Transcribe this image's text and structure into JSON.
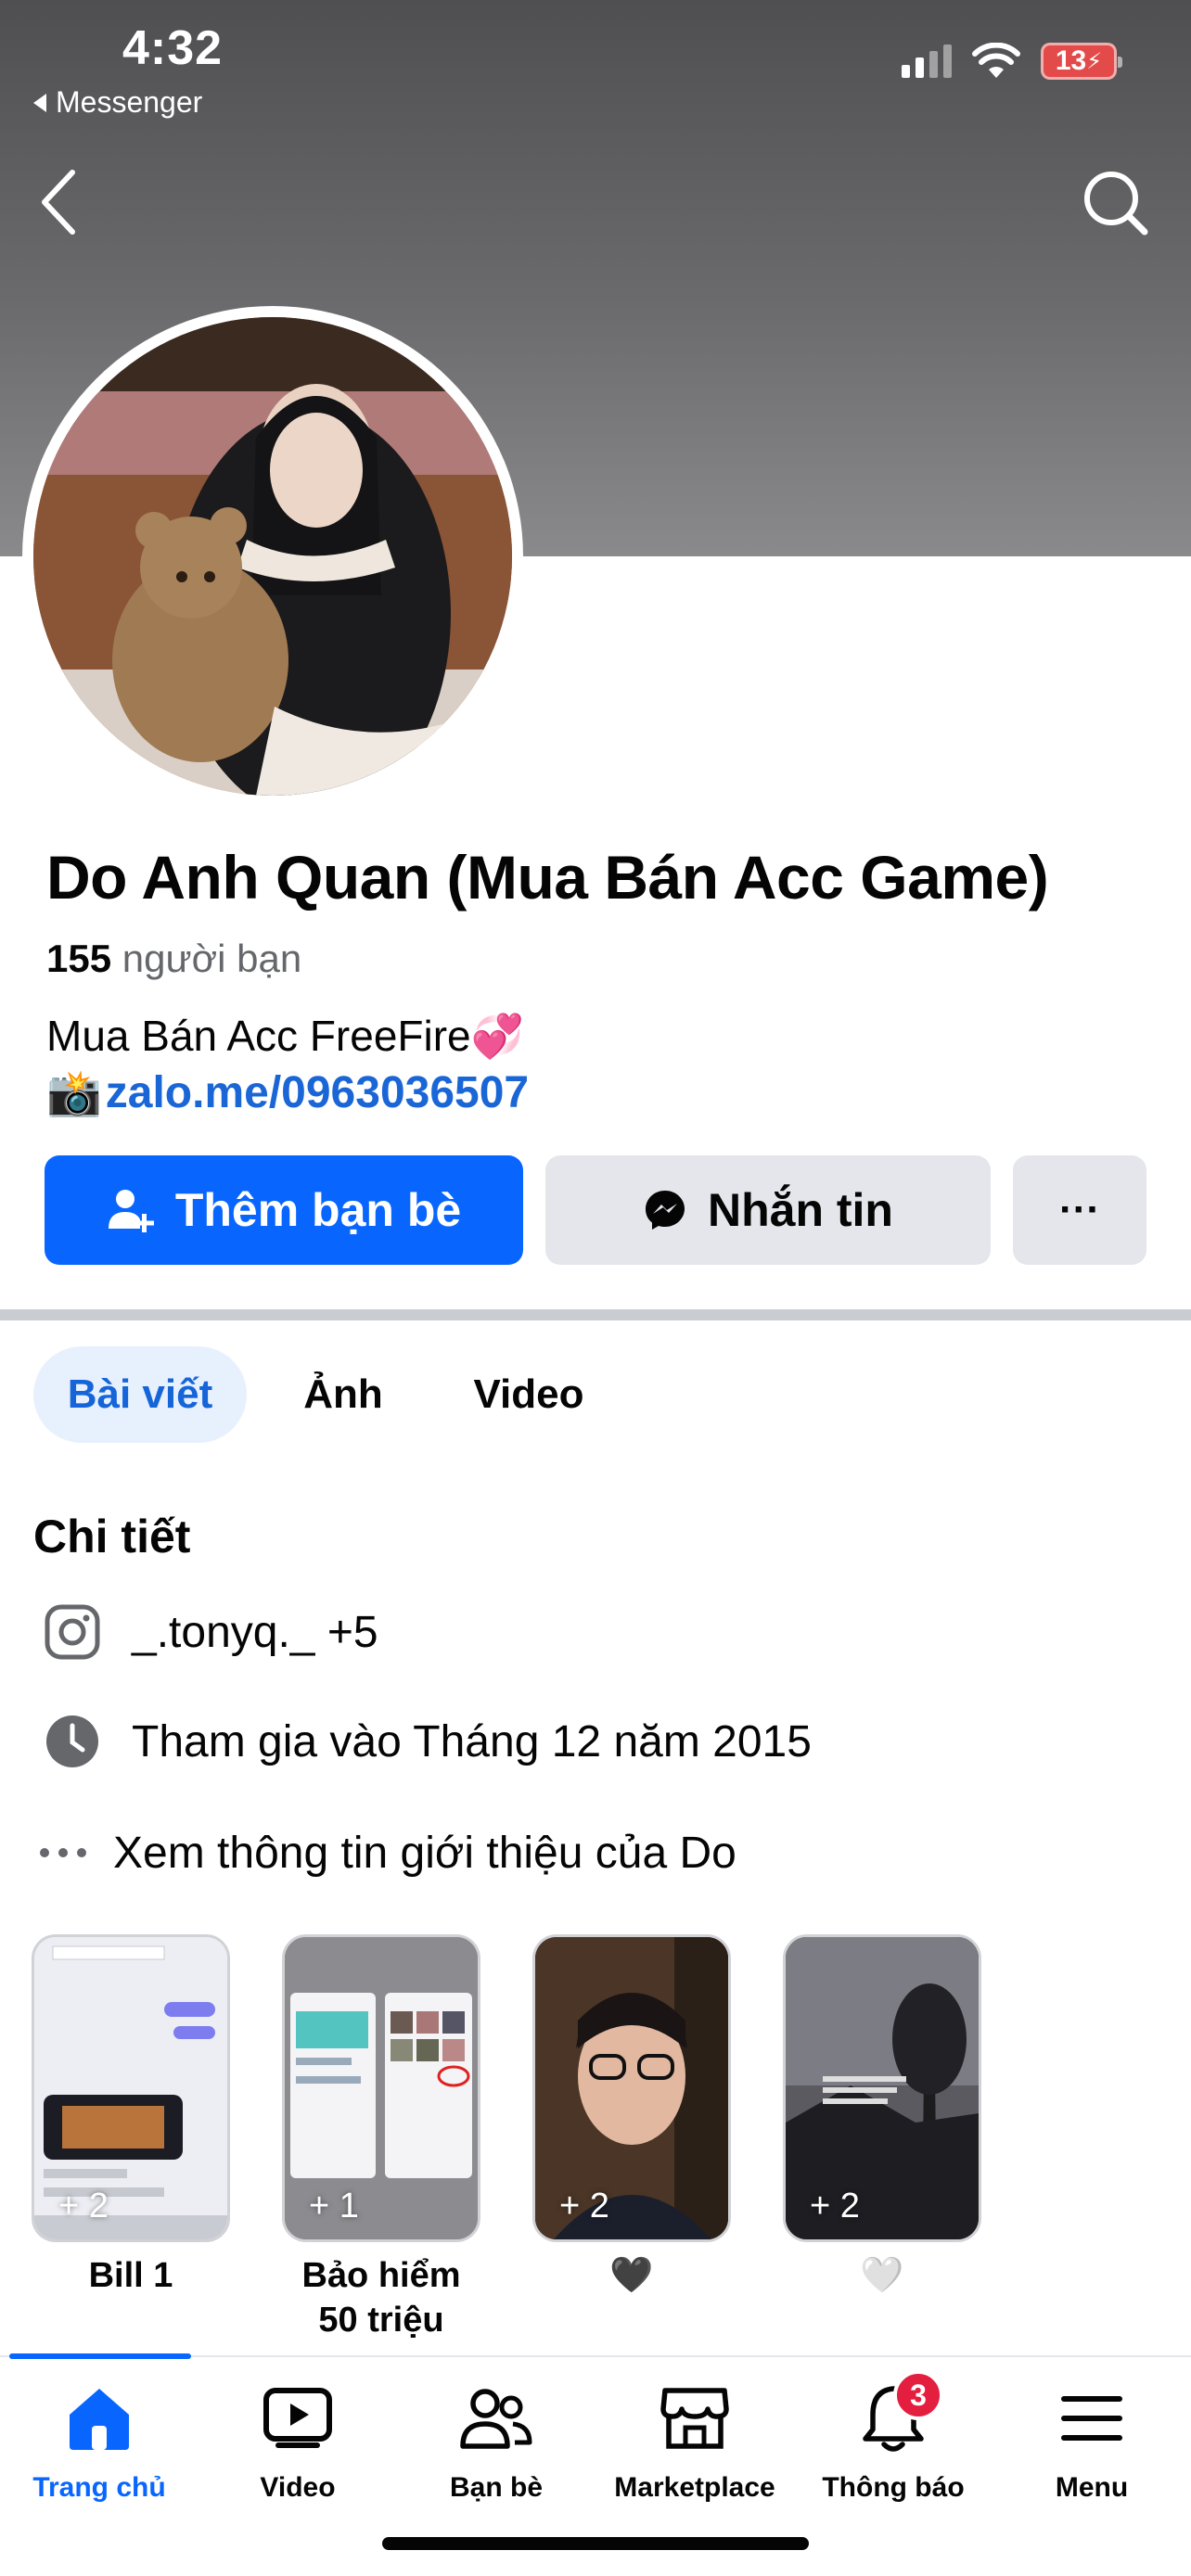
{
  "status_bar": {
    "time": "4:32",
    "back_app": "Messenger",
    "battery": "13"
  },
  "profile": {
    "name": "Do Anh Quan (Mua Bán Acc Game)",
    "friends_count": "155",
    "friends_label": "người bạn",
    "bio_line1": "Mua Bán Acc FreeFire💞",
    "bio_line2_emoji": "📸",
    "bio_link": "zalo.me/0963036507"
  },
  "actions": {
    "add_friend": "Thêm bạn bè",
    "message": "Nhắn tin",
    "more": "···"
  },
  "tabs": [
    "Bài viết",
    "Ảnh",
    "Video"
  ],
  "details": {
    "title": "Chi tiết",
    "instagram": "_.tonyq._ +5",
    "joined": "Tham gia vào Tháng 12 năm 2015",
    "about": "Xem thông tin giới thiệu của Do"
  },
  "highlights": [
    {
      "count": "+ 2",
      "caption": "Bill 1"
    },
    {
      "count": "+ 1",
      "caption": "Bảo hiểm\n50 triệu"
    },
    {
      "count": "+ 2",
      "caption": "🖤"
    },
    {
      "count": "+ 2",
      "caption": "🤍"
    }
  ],
  "bottom_nav": {
    "items": [
      "Trang chủ",
      "Video",
      "Bạn bè",
      "Marketplace",
      "Thông báo",
      "Menu"
    ],
    "notification_badge": "3",
    "active_color": "#0866ff"
  },
  "colors": {
    "primary": "#0866ff",
    "link": "#1a66d6",
    "secondary_button": "#e4e6eb",
    "badge": "#e41e3f"
  }
}
